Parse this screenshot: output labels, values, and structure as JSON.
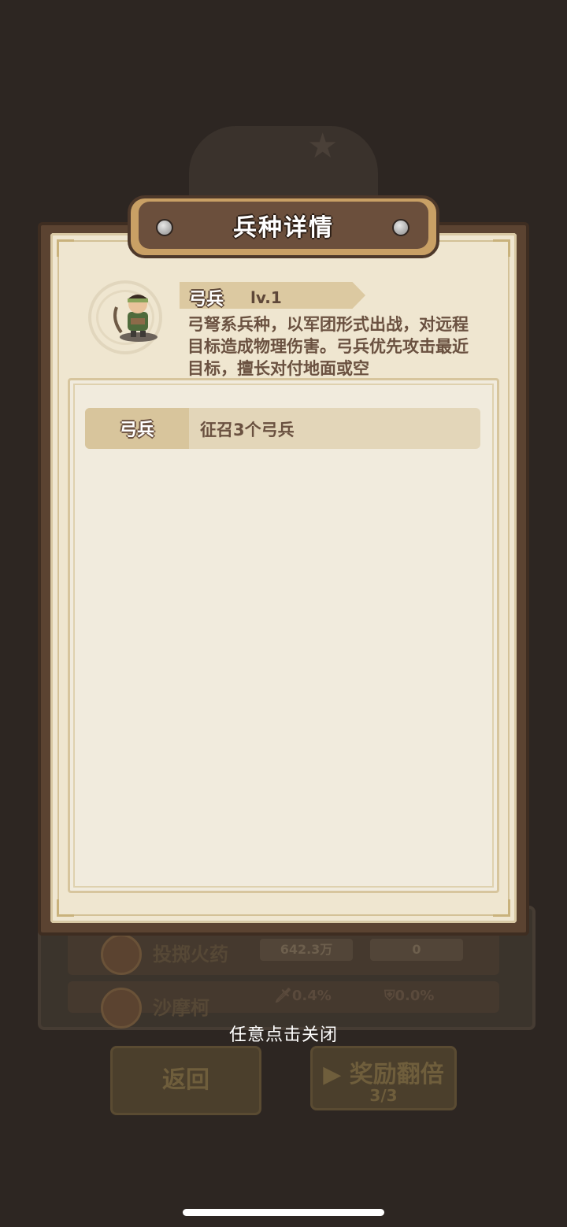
{
  "dialog": {
    "title": "兵种详情",
    "unit": {
      "name": "弓兵",
      "level": "lv.1",
      "description": "弓弩系兵种，以军团形式出战，对远程目标造成物理伤害。弓兵优先攻击最近目标，擅长对付地面或空"
    },
    "info_rows": [
      {
        "label": "弓兵",
        "value": "征召3个弓兵"
      }
    ]
  },
  "close_hint": "任意点击关闭",
  "background": {
    "rows": [
      {
        "name": "投掷火药",
        "cell1": "642.3万",
        "cell2": "0"
      },
      {
        "name": "沙摩柯",
        "stat1": "🗡0.4%",
        "stat2": "⛨0.0%"
      }
    ],
    "back_button": "返回",
    "reward_button": "奖励翻倍",
    "reward_count": "3/3"
  },
  "colors": {
    "frame": "#5b4331",
    "paper": "#efe6d0",
    "title_bar": "#6b4f3c",
    "text_brown": "#6a5140"
  }
}
